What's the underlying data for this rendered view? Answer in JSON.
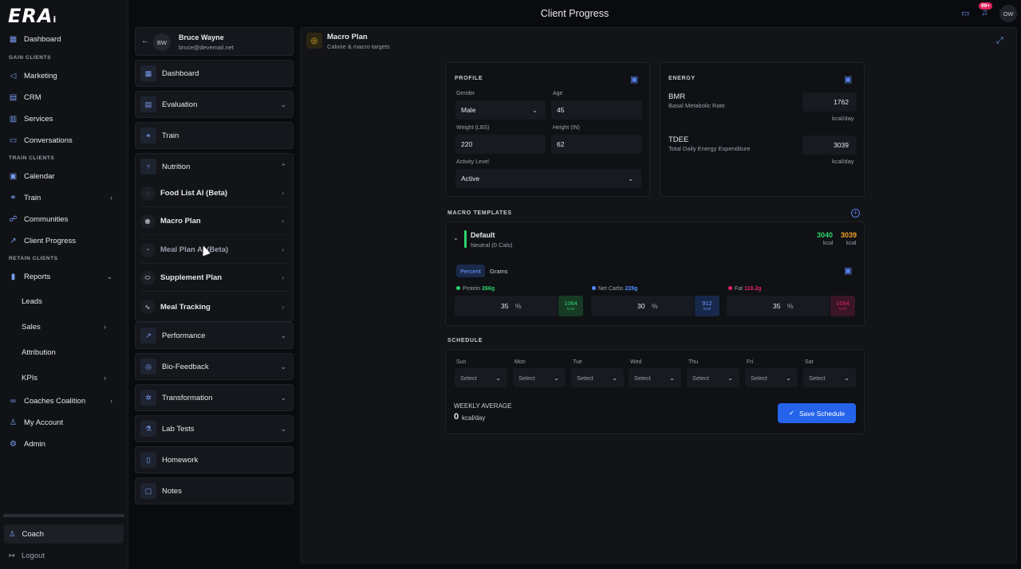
{
  "app": {
    "logo": "ERA",
    "logo_suffix": "i",
    "page_title": "Client Progress",
    "notification_badge": "99+",
    "user_initials": "OW",
    "accent": "#2563eb"
  },
  "nav": {
    "items": [
      {
        "label": "Dashboard",
        "icon": "grid-icon"
      },
      {
        "section": "GAIN CLIENTS"
      },
      {
        "label": "Marketing",
        "icon": "megaphone-icon"
      },
      {
        "label": "CRM",
        "icon": "crm-icon"
      },
      {
        "label": "Services",
        "icon": "services-icon"
      },
      {
        "label": "Conversations",
        "icon": "chat-icon"
      },
      {
        "section": "TRAIN CLIENTS"
      },
      {
        "label": "Calendar",
        "icon": "calendar-icon"
      },
      {
        "label": "Train",
        "icon": "train-icon"
      },
      {
        "label": "Communities",
        "icon": "communities-icon"
      },
      {
        "label": "Client Progress",
        "icon": "trend-icon"
      },
      {
        "section": "RETAIN CLIENTS"
      },
      {
        "label": "Reports",
        "icon": "reports-icon"
      },
      {
        "label": "Leads"
      },
      {
        "label": "Sales"
      },
      {
        "label": "Attribution"
      },
      {
        "label": "KPIs"
      },
      {
        "label": "Coaches Coalition",
        "icon": "infinity-icon"
      },
      {
        "label": "My Account",
        "icon": "user-icon"
      },
      {
        "label": "Admin",
        "icon": "gear-icon"
      }
    ],
    "coach": "Coach",
    "logout": "Logout"
  },
  "client": {
    "initials": "BW",
    "name": "Bruce Wayne",
    "email": "bruce@devemail.net"
  },
  "middle": {
    "dashboard": "Dashboard",
    "evaluation": "Evaluation",
    "train": "Train",
    "nutrition": "Nutrition",
    "nutrition_items": [
      "Food List AI (Beta)",
      "Macro Plan",
      "Meal Plan AI (Beta)",
      "Supplement Plan",
      "Meal Tracking"
    ],
    "performance": "Performance",
    "biofeedback": "Bio-Feedback",
    "transformation": "Transformation",
    "labtests": "Lab Tests",
    "homework": "Homework",
    "notes": "Notes"
  },
  "macro_plan": {
    "title": "Macro Plan",
    "subtitle": "Calorie & macro targets",
    "profile": {
      "label": "PROFILE",
      "gender_label": "Gender",
      "gender": "Male",
      "age_label": "Age",
      "age": "45",
      "weight_label": "Weight (LBS)",
      "weight": "220",
      "height_label": "Height (IN)",
      "height": "62",
      "activity_label": "Activity Level",
      "activity": "Active"
    },
    "energy": {
      "label": "ENERGY",
      "bmr_title": "BMR",
      "bmr_sub": "Basal Metabolic Rate",
      "bmr": "1762",
      "bmr_unit": "kcal/day",
      "tdee_title": "TDEE",
      "tdee_sub": "Total Daily Energy Expenditure",
      "tdee": "3039",
      "tdee_unit": "kcal/day"
    },
    "templates": {
      "label": "MACRO TEMPLATES",
      "name": "Default",
      "sub": "Neutral (0 Cals)",
      "kcal_target": "3040",
      "kcal_actual": "3039",
      "kcal_unit": "kcal",
      "tab_percent": "Percent",
      "tab_grams": "Grams",
      "protein_label": "Protein",
      "protein_grams": "266g",
      "protein_pct": "35",
      "protein_kcal": "1064",
      "carbs_label": "Net Carbs",
      "carbs_grams": "228g",
      "carbs_pct": "30",
      "carbs_kcal": "912",
      "fat_label": "Fat",
      "fat_grams": "118.2g",
      "fat_pct": "35",
      "fat_kcal": "1064",
      "pct_sign": "%",
      "kcal_small": "kcal",
      "colors": {
        "protein": "#2fd36b",
        "carbs": "#4f8cff",
        "fat": "#e0245e"
      }
    },
    "schedule": {
      "label": "SCHEDULE",
      "days": [
        "Sun",
        "Mon",
        "Tue",
        "Wed",
        "Thu",
        "Fri",
        "Sat"
      ],
      "select_placeholder": "Select",
      "weekly_avg_label": "WEEKLY AVERAGE",
      "weekly_avg_value": "0",
      "weekly_avg_unit": "kcal/day",
      "save_button": "Save Schedule"
    }
  }
}
